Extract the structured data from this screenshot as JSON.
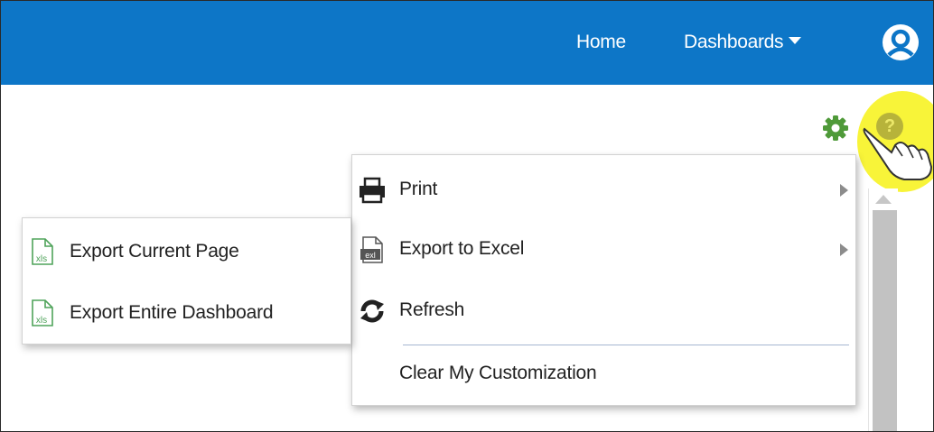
{
  "header": {
    "nav": {
      "home": "Home",
      "dashboards": "Dashboards"
    },
    "brand_color": "#0d76c7"
  },
  "toolbar": {
    "gear_icon": "gear-icon",
    "help_icon": "help-icon",
    "help_glyph": "?"
  },
  "menu": {
    "items": [
      {
        "label": "Print",
        "icon": "printer-icon",
        "has_submenu": true
      },
      {
        "label": "Export to Excel",
        "icon": "excel-icon",
        "has_submenu": true
      },
      {
        "label": "Refresh",
        "icon": "refresh-icon",
        "has_submenu": false
      },
      {
        "label": "Clear My Customization",
        "icon": "",
        "has_submenu": false
      }
    ]
  },
  "submenu": {
    "items": [
      {
        "label": "Export Current Page",
        "icon": "xls-file-icon"
      },
      {
        "label": "Export Entire Dashboard",
        "icon": "xls-file-icon"
      }
    ]
  },
  "colors": {
    "gear": "#4f9a39",
    "highlight": "#f7f328",
    "xls_icon": "#4fa35a"
  }
}
